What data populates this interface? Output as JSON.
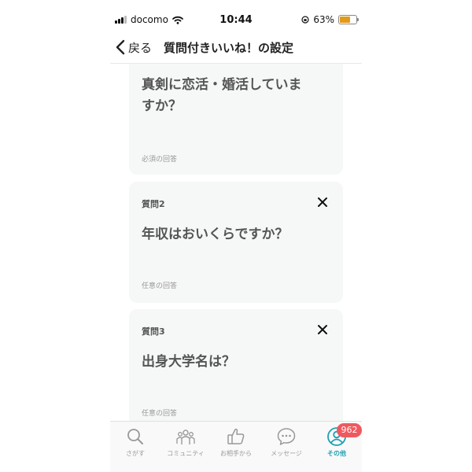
{
  "status_bar": {
    "carrier": "docomo",
    "time": "10:44",
    "battery_percent": "63%",
    "battery_level": 0.63,
    "battery_color": "#e09b1a"
  },
  "nav": {
    "back_label": "戻る",
    "title": "質問付きいいね！の設定"
  },
  "cards": [
    {
      "question_line1": "真剣に恋活・婚活していま",
      "question_line2": "すか？",
      "requirement": "必須の回答"
    },
    {
      "label": "質問2",
      "question": "年収はおいくらですか？",
      "requirement": "任意の回答"
    },
    {
      "label": "質問3",
      "question": "出身大学名は？",
      "requirement": "任意の回答"
    }
  ],
  "tabs": [
    {
      "label": "さがす",
      "icon": "search-icon"
    },
    {
      "label": "コミュニティ",
      "icon": "community-icon"
    },
    {
      "label": "お相手から",
      "icon": "thumbs-up-icon"
    },
    {
      "label": "メッセージ",
      "icon": "message-icon"
    },
    {
      "label": "その他",
      "icon": "profile-icon",
      "active": true
    }
  ],
  "badge": "962",
  "colors": {
    "accent": "#1f9fb2",
    "badge": "#f0585f",
    "card_background": "#f6f7f7"
  }
}
